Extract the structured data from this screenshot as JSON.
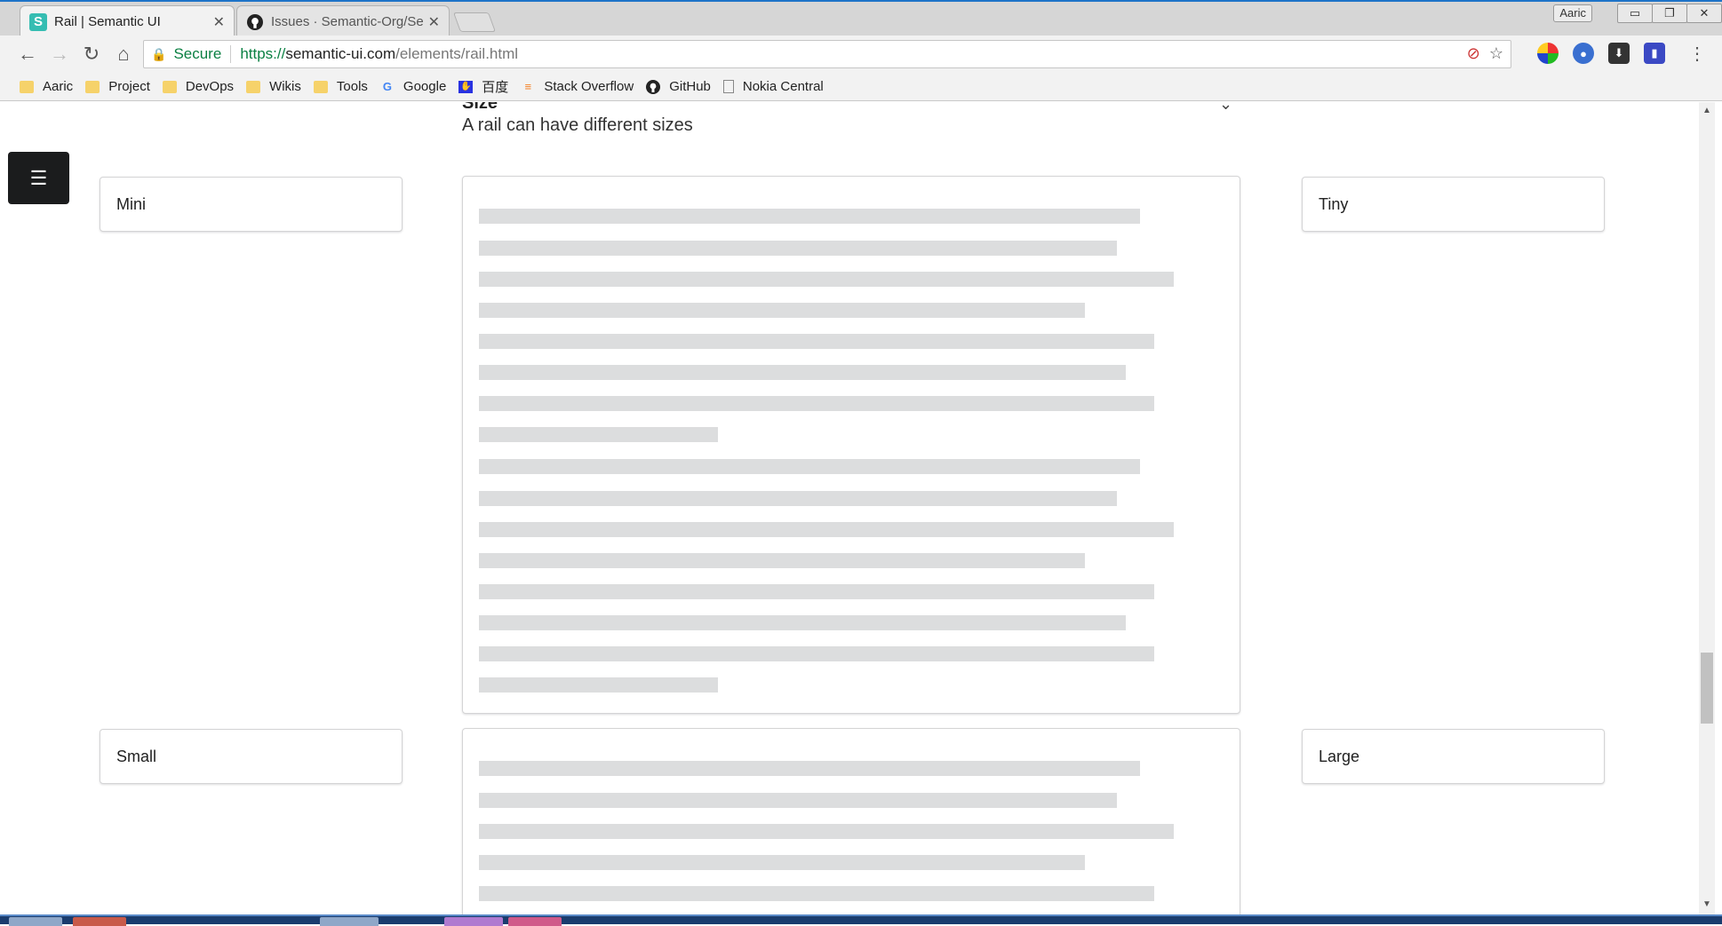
{
  "browser": {
    "tabs": [
      {
        "title": "Rail | Semantic UI",
        "favicon": "S",
        "active": true
      },
      {
        "title": "Issues · Semantic-Org/Se",
        "favicon": "github-icon",
        "active": false
      }
    ],
    "window_user": "Aaric",
    "secure_label": "Secure",
    "url": {
      "scheme": "https://",
      "host": "semantic-ui.com",
      "path": "/elements/rail.html"
    },
    "bookmarks": [
      {
        "label": "Aaric",
        "icon": "folder-icon"
      },
      {
        "label": "Project",
        "icon": "folder-icon"
      },
      {
        "label": "DevOps",
        "icon": "folder-icon"
      },
      {
        "label": "Wikis",
        "icon": "folder-icon"
      },
      {
        "label": "Tools",
        "icon": "folder-icon"
      },
      {
        "label": "Google",
        "icon": "google-icon"
      },
      {
        "label": "百度",
        "icon": "baidu-icon"
      },
      {
        "label": "Stack Overflow",
        "icon": "stackoverflow-icon"
      },
      {
        "label": "GitHub",
        "icon": "github-icon"
      },
      {
        "label": "Nokia Central",
        "icon": "page-icon"
      }
    ]
  },
  "page": {
    "section_title": "Size",
    "section_description": "A rail can have different sizes",
    "rails": {
      "first_left": "Mini",
      "first_right": "Tiny",
      "second_left": "Small",
      "second_right": "Large"
    }
  },
  "colors": {
    "accent_green": "#0b8043",
    "placeholder_line": "#dcddde",
    "sidebar_button": "#1b1c1d"
  }
}
